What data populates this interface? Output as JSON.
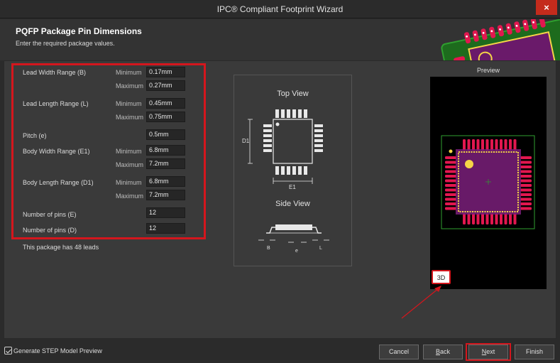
{
  "window": {
    "title": "IPC® Compliant Footprint Wizard",
    "close_glyph": "×"
  },
  "header": {
    "title": "PQFP Package Pin Dimensions",
    "subtitle": "Enter the required package values."
  },
  "fields": {
    "lead_width": {
      "label": "Lead Width Range (B)",
      "min_label": "Minimum",
      "min": "0.17mm",
      "max_label": "Maximum",
      "max": "0.27mm"
    },
    "lead_length": {
      "label": "Lead Length Range (L)",
      "min_label": "Minimum",
      "min": "0.45mm",
      "max_label": "Maximum",
      "max": "0.75mm"
    },
    "pitch": {
      "label": "Pitch (e)",
      "value": "0.5mm"
    },
    "body_width": {
      "label": "Body Width Range (E1)",
      "min_label": "Minimum",
      "min": "6.8mm",
      "max_label": "Maximum",
      "max": "7.2mm"
    },
    "body_length": {
      "label": "Body Length Range (D1)",
      "min_label": "Minimum",
      "min": "6.8mm",
      "max_label": "Maximum",
      "max": "7.2mm"
    },
    "pins_e": {
      "label": "Number of pins (E)",
      "value": "12"
    },
    "pins_d": {
      "label": "Number of pins (D)",
      "value": "12"
    }
  },
  "info": "This package has 48 leads",
  "diagram": {
    "top_view": "Top View",
    "side_view": "Side View",
    "labels": {
      "d1": "D1",
      "e1": "E1",
      "b": "B",
      "e": "e",
      "l": "L"
    }
  },
  "preview": {
    "label": "Preview",
    "btn_3d": "3D"
  },
  "footer": {
    "step_checkbox": "Generate STEP Model Preview",
    "cancel": "Cancel",
    "back_u": "B",
    "back_rest": "ack",
    "next_u": "N",
    "next_rest": "ext",
    "finish": "Finish"
  },
  "colors": {
    "accent_red": "#d4161d",
    "pad_red": "#e2174f",
    "silk_yellow": "#f5d547",
    "outline_green": "#2fa02f"
  }
}
